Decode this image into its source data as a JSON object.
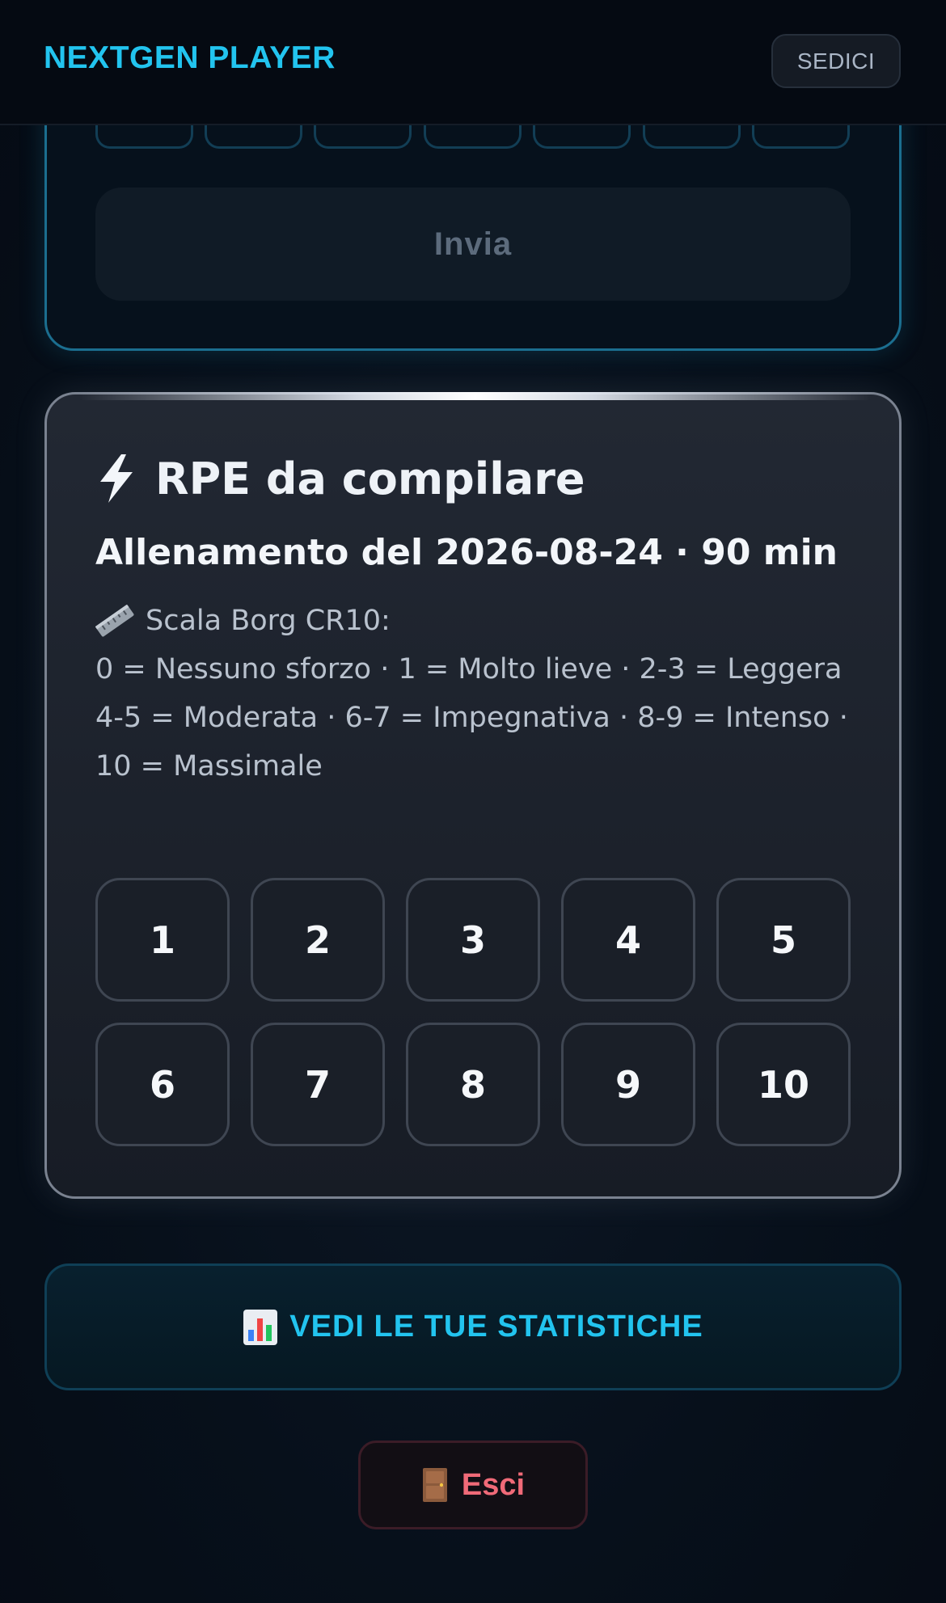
{
  "header": {
    "brand": "NEXTGEN PLAYER",
    "team_label": "SEDICI"
  },
  "previous_card": {
    "submit_label": "Invia"
  },
  "rpe_card": {
    "title": "RPE da compilare",
    "title_icon": "lightning-bolt-icon",
    "session": "Allenamento del 2026-08-24 · 90 min",
    "scale_icon": "ruler-icon",
    "scale_title": "Scala Borg CR10:",
    "scale_line1": "0 = Nessuno sforzo · 1 = Molto lieve · 2-3 = Leggera",
    "scale_line2": "4-5 = Moderata · 6-7 = Impegnativa · 8-9 = Intenso · 10 = Massimale",
    "options": [
      "1",
      "2",
      "3",
      "4",
      "5",
      "6",
      "7",
      "8",
      "9",
      "10"
    ]
  },
  "stats_button": {
    "icon": "bar-chart-icon",
    "label": "VEDI LE TUE STATISTICHE"
  },
  "exit_button": {
    "icon": "door-icon",
    "label": "Esci"
  },
  "colors": {
    "accent": "#22c4ef",
    "danger": "#f06a78",
    "background": "#07101b"
  }
}
